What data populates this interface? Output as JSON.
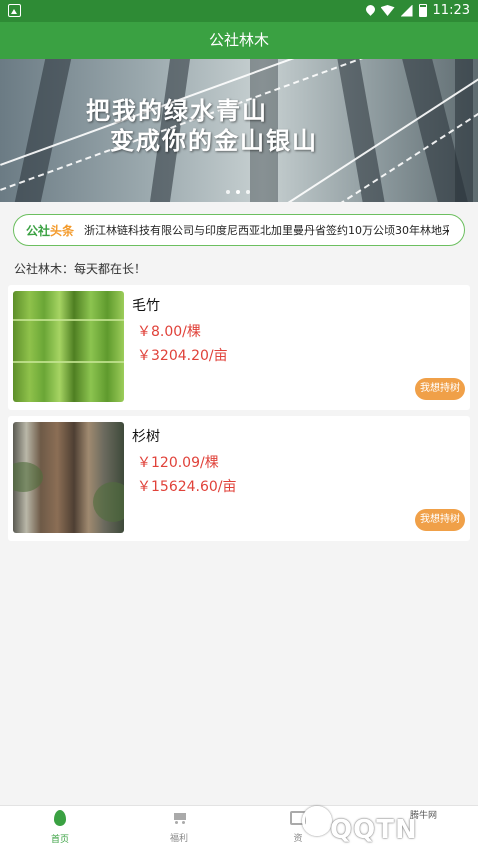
{
  "status_bar": {
    "time": "11:23"
  },
  "app_bar": {
    "title": "公社林木"
  },
  "banner": {
    "line1": "把我的绿水青山",
    "line2": "变成你的金山银山",
    "slide_count": 3,
    "active_slide": 1
  },
  "news": {
    "logo_part1": "公社",
    "logo_part2": "头条",
    "text": "浙江林链科技有限公司与印度尼西亚北加里曼丹省签约10万公顷30年林地采..."
  },
  "motto": "公社林木：每天都在长！",
  "products": [
    {
      "name": "毛竹",
      "price_per_tree": "￥8.00/棵",
      "price_per_mu": "￥3204.20/亩",
      "button": "我想持树"
    },
    {
      "name": "杉树",
      "price_per_tree": "￥120.09/棵",
      "price_per_mu": "￥15624.60/亩",
      "button": "我想持树"
    }
  ],
  "bottom_nav": {
    "home": "首页",
    "fuli": "福利",
    "assets": "资"
  },
  "watermark": {
    "brand": "QQTN",
    "small": "腾牛网"
  },
  "colors": {
    "primary": "#3aa142",
    "price": "#e0423a",
    "button": "#f0a048"
  }
}
